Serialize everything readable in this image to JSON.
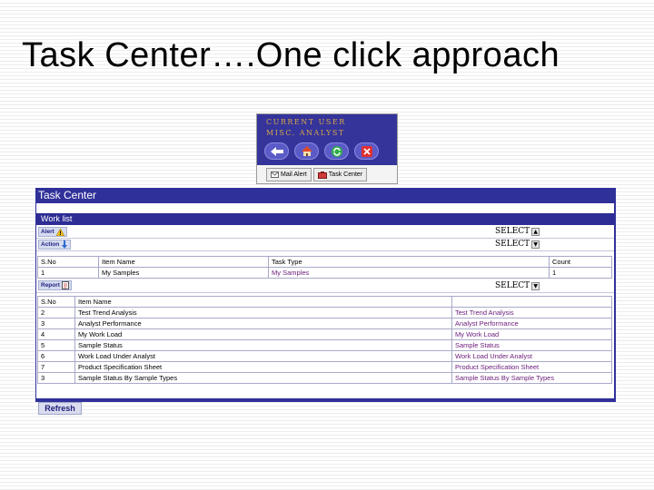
{
  "slide": {
    "title": "Task Center….One click approach"
  },
  "user_panel": {
    "caption_line1": "Current User",
    "caption_line2": "Misc. Analyst",
    "toolbar": [
      {
        "icon": "back-arrow-icon"
      },
      {
        "icon": "home-icon"
      },
      {
        "icon": "refresh-icon"
      },
      {
        "icon": "close-icon"
      }
    ],
    "tabs": [
      {
        "label": "Mail Alert",
        "icon": "mail-icon"
      },
      {
        "label": "Task Center",
        "icon": "task-icon"
      }
    ]
  },
  "task_center": {
    "title": "Task Center",
    "worklist_label": "Work list",
    "alert_label": "Alert",
    "action_label": "Action",
    "report_label": "Report",
    "alert_select": "SELECT",
    "action_select": "SELECT",
    "report_select": "SELECT",
    "work_table": {
      "headers": [
        "S.No",
        "Item Name",
        "Task Type",
        "Count"
      ],
      "rows": [
        {
          "sno": "1",
          "item": "My Samples",
          "type": "My Samples",
          "count": "1"
        }
      ]
    },
    "report_table": {
      "headers": [
        "S.No",
        "Item Name",
        ""
      ],
      "rows": [
        {
          "sno": "2",
          "item": "Test Trend Analysis",
          "link": "Test Trend Analysis"
        },
        {
          "sno": "3",
          "item": "Analyst Performance",
          "link": "Analyst Performance"
        },
        {
          "sno": "4",
          "item": "My Work Load",
          "link": "My Work Load"
        },
        {
          "sno": "5",
          "item": "Sample Status",
          "link": "Sample Status"
        },
        {
          "sno": "6",
          "item": "Work Load Under Analyst",
          "link": "Work Load Under Analyst"
        },
        {
          "sno": "7",
          "item": "Product Specification Sheet",
          "link": "Product Specification Sheet"
        },
        {
          "sno": "3",
          "item": "Sample Status By Sample Types",
          "link": "Sample Status By Sample Types"
        }
      ]
    },
    "refresh_label": "Refresh"
  },
  "colors": {
    "header_blue": "#30309a",
    "link": "#6a1a7a",
    "caption_gold": "#d8a84a"
  }
}
